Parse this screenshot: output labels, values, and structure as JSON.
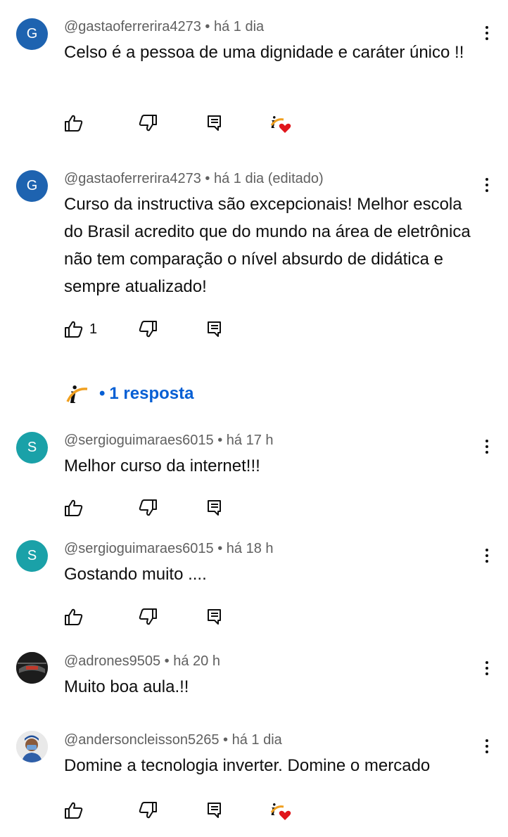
{
  "comments": [
    {
      "author": "@gastaoferrerira4273",
      "time": "há 1 dia",
      "avatar_letter": "G",
      "text": "Celso é a pessoa de uma dignidade e caráter único !!"
    },
    {
      "author": "@gastaoferrerira4273",
      "time": "há 1 dia (editado)",
      "avatar_letter": "G",
      "text": "Curso da instructiva são excepcionais! Melhor escola do Brasil acredito que do mundo na área de eletrônica não tem comparação o nível absurdo de didática e sempre atualizado!",
      "likes": "1",
      "replies_label": "1 resposta"
    },
    {
      "author": "@sergioguimaraes6015",
      "time": "há 17 h",
      "avatar_letter": "S",
      "text": "Melhor curso da internet!!!"
    },
    {
      "author": "@sergioguimaraes6015",
      "time": "há 18 h",
      "avatar_letter": "S",
      "text": "Gostando muito ...."
    },
    {
      "author": "@adrones9505",
      "time": "há 20 h",
      "text": "Muito boa aula.!!"
    },
    {
      "author": "@andersoncleisson5265",
      "time": "há 1 dia",
      "text": "Domine a tecnologia inverter. Domine o mercado"
    }
  ],
  "separator": "•",
  "colors": {
    "avatar_g": "#1e63b0",
    "avatar_s": "#1aa1a8",
    "reply_link": "#065fd4",
    "heart": "#e0161c",
    "creator_logo_orange": "#f0a020"
  },
  "icons": {
    "like": "thumb-up-icon",
    "dislike": "thumb-down-icon",
    "reply": "comment-reply-icon",
    "creator_heart": "creator-heart-icon",
    "more": "more-vert-icon"
  }
}
